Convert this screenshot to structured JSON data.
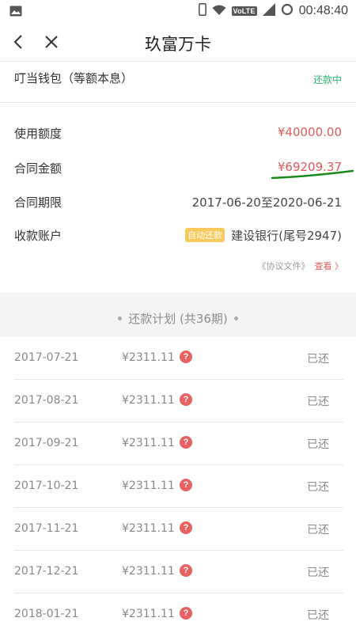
{
  "status_bar": {
    "time": "00:48:40",
    "volte": "VoLTE",
    "icons": [
      "image-icon",
      "phone-icon",
      "wifi-icon",
      "signal-icon",
      "sync-icon"
    ]
  },
  "header": {
    "title": "玖富万卡",
    "back_icon": "chevron-left-icon",
    "close_icon": "close-icon"
  },
  "product": {
    "name": "叮当钱包（等额本息）",
    "status": "还款中",
    "status_color": "#2bb673"
  },
  "details": [
    {
      "label": "使用额度",
      "value": "¥40000.00"
    },
    {
      "label": "合同金额",
      "value": "¥69209.37"
    },
    {
      "label": "合同期限",
      "value": "2017-06-20至2020-06-21"
    },
    {
      "label": "收款账户",
      "badge": "自动还款",
      "value": "建设银行(尾号2947)"
    }
  ],
  "docs": {
    "label": "《协议文件》",
    "link": "查看 〉"
  },
  "plan": {
    "title": "还款计划 (共36期)"
  },
  "schedule": [
    {
      "date": "2017-07-21",
      "amount": "¥2311.11",
      "status": "已还"
    },
    {
      "date": "2017-08-21",
      "amount": "¥2311.11",
      "status": "已还"
    },
    {
      "date": "2017-09-21",
      "amount": "¥2311.11",
      "status": "已还"
    },
    {
      "date": "2017-10-21",
      "amount": "¥2311.11",
      "status": "已还"
    },
    {
      "date": "2017-11-21",
      "amount": "¥2311.11",
      "status": "已还"
    },
    {
      "date": "2017-12-21",
      "amount": "¥2311.11",
      "status": "已还"
    },
    {
      "date": "2018-01-21",
      "amount": "¥2311.11",
      "status": "已还"
    }
  ],
  "colors": {
    "accent_red": "#e05a5a",
    "green": "#2bb673",
    "badge_yellow": "#f7c85c"
  }
}
